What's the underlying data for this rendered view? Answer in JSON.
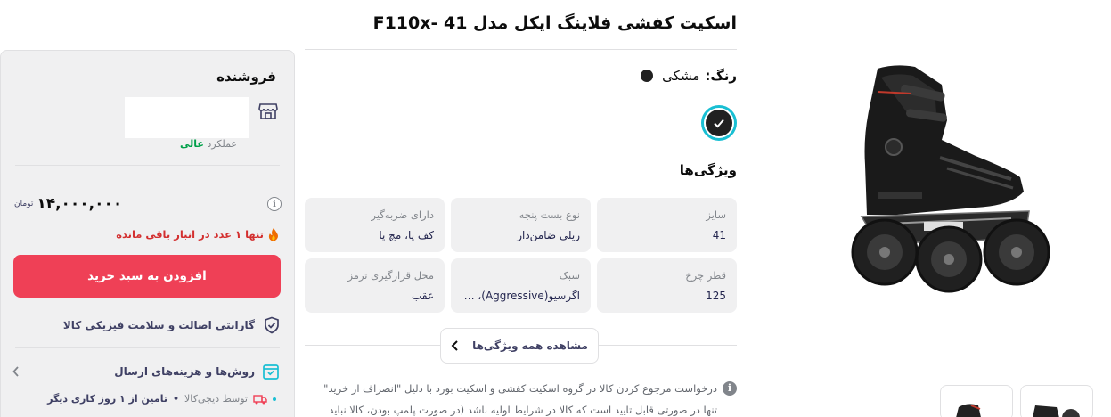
{
  "product": {
    "title": "اسکیت کفشی فلاینگ ایکل مدل F110x- 41",
    "color_label": "رنگ:",
    "color_value": "مشکی",
    "color_hex": "#212121",
    "features_title": "ویژگی‌ها",
    "attributes": [
      {
        "key": "سایز",
        "value": "41"
      },
      {
        "key": "نوع بست پنجه",
        "value": "ریلی ضامن‌دار"
      },
      {
        "key": "دارای ضربه‌گیر",
        "value": "کف پا، مچ پا"
      },
      {
        "key": "قطر چرخ",
        "value": "125"
      },
      {
        "key": "سبک",
        "value": "اگرسیو(Aggressive)، سب..."
      },
      {
        "key": "محل قرارگیری ترمز",
        "value": "عقب"
      }
    ],
    "see_all_label": "مشاهده همه ویژگی‌ها",
    "notice_line1": "درخواست مرجوع کردن کالا در گروه اسکیت کفشی و اسکیت بورد با دلیل \"انصراف از خرید\"",
    "notice_line2": "تنها در صورتی قابل تایید است که کالا در شرایط اولیه باشد (در صورت پلمپ بودن، کالا نباید"
  },
  "seller": {
    "title": "فروشنده",
    "performance_label": "عملکرد",
    "performance_value": "عالی",
    "price": "۱۴,۰۰۰,۰۰۰",
    "currency": "تومان",
    "stock_warning": "تنها ۱ عدد در انبار باقی مانده",
    "add_to_cart": "افزودن به سبد خرید",
    "warranty": "گارانتی اصالت و سلامت فیزیکی کالا",
    "shipping_title": "روش‌ها و هزینه‌های ارسال",
    "shipping_by": "توسط دیجی‌کالا",
    "shipping_detail": "تامین از ۱ روز کاری دیگر"
  },
  "colors": {
    "accent": "#ef4056",
    "teal": "#19bfd3",
    "success": "#00a049",
    "danger": "#d32f2f"
  },
  "icons": [
    "shop-icon",
    "info-icon",
    "fire-icon",
    "shield-check-icon",
    "shipping-box-icon",
    "chevron-left-icon",
    "truck-icon",
    "checkmark-icon"
  ]
}
